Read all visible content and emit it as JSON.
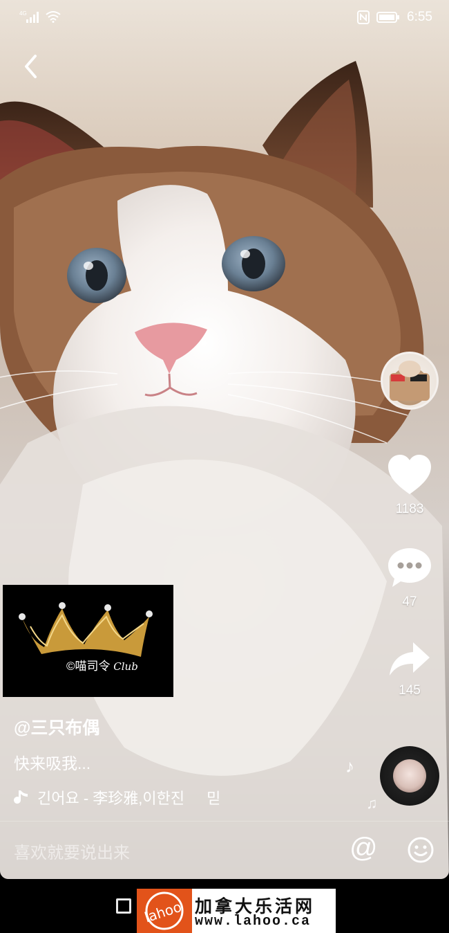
{
  "status_bar": {
    "network": "4G",
    "time": "6:55"
  },
  "video": {
    "subject": "cat-photo"
  },
  "rail": {
    "likes": "1183",
    "comments": "47",
    "shares": "145"
  },
  "overlay_logo": {
    "text": "©喵司令",
    "club": "Club"
  },
  "caption": {
    "username": "@三只布偶",
    "description": "快来吸我...",
    "music_title": "긴어요 - 李珍雅,이한진",
    "music_tail": "믿"
  },
  "comment_bar": {
    "placeholder": "喜欢就要说出来",
    "at_label": "@"
  },
  "watermark": {
    "logo_text": "lahoo",
    "title": "加拿大乐活网",
    "url": "www.lahoo.ca"
  },
  "colors": {
    "watermark_orange": "#e2531a",
    "like_white": "#ffffff",
    "crown_gold": "#c99a3a"
  },
  "icons": [
    "back-arrow-icon",
    "signal-icon",
    "wifi-icon",
    "nfc-icon",
    "battery-icon",
    "heart-icon",
    "comment-bubble-icon",
    "share-arrow-icon",
    "music-note-icon",
    "emoji-icon",
    "crown-icon",
    "recent-apps-icon"
  ]
}
